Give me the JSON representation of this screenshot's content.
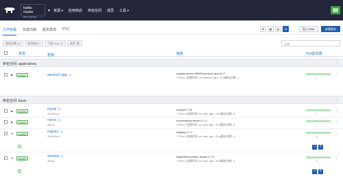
{
  "topbar": {
    "cluster_name": "baidu-cluster",
    "cluster_sub": "sms-group",
    "nav": [
      "资源",
      "应用商店",
      "命名空间",
      "成员",
      "工具"
    ],
    "bg_color": "#24273a"
  },
  "tabs": [
    {
      "label": "工作负载",
      "active": true
    },
    {
      "label": "负载均衡",
      "active": false
    },
    {
      "label": "服务发现",
      "active": false
    },
    {
      "label": "PVC",
      "active": false
    }
  ],
  "toolbar": {
    "import_yaml": "导入YAML",
    "deploy_service": "部署服务"
  },
  "actions": [
    "重新部署 (0)",
    "暂停编排 ⏸",
    "下载YAML ⬇",
    "删除 🗑"
  ],
  "filter_placeholder": "过滤",
  "table": {
    "headers": {
      "state": "状态",
      "name": "名称",
      "image": "镜像",
      "pods": "Pod副本数"
    }
  },
  "groups": [
    {
      "label": "命名空间: applications",
      "rows": [
        {
          "state": "Active",
          "name": "service2-app",
          "port": "",
          "image": "registry-server:30000/service2-app:10.2",
          "image_sub": "??Pod / 创建时间: 19 minutes ago / Pod重启次数: 1",
          "pods": "1",
          "expanded": false
        }
      ]
    },
    {
      "label": "命名空间: basic",
      "rows": [
        {
          "state": "Active",
          "name": "mysql",
          "port": "40000/tcp",
          "image": "mysql:5.7.28",
          "image_sub": "??Pod / 创建时间: an hour ago / Pod重启次数: 0",
          "pods": "1",
          "expanded": false
        },
        {
          "state": "Active",
          "name": "nacos",
          "port": "48/tcp",
          "image": "nacos/nacos-server:1.1.4",
          "image_sub": "??Pod / 创建时间: an hour ago / Pod重启次数: 0",
          "pods": "1",
          "expanded": false
        },
        {
          "state": "Active",
          "name": "registry",
          "port": "30000/tcp",
          "image": "registry:2.7.1",
          "image_sub": "??Pod / 创建时间: an hour ago / Pod重启次数: 0",
          "pods": "1",
          "expanded": true
        },
        {
          "state": "Active",
          "name": "sentinel",
          "port": "48/tcp",
          "image": "anjia0532/sentinel-docker:1.7.0",
          "image_sub": "??Pod / 创建时间: an hour ago / Pod重启次数: 0",
          "pods": "1",
          "expanded": true
        }
      ]
    }
  ],
  "colors": {
    "accent": "#1976d2",
    "active_badge": "#4caf50",
    "button_blue": "#1e5eab"
  }
}
